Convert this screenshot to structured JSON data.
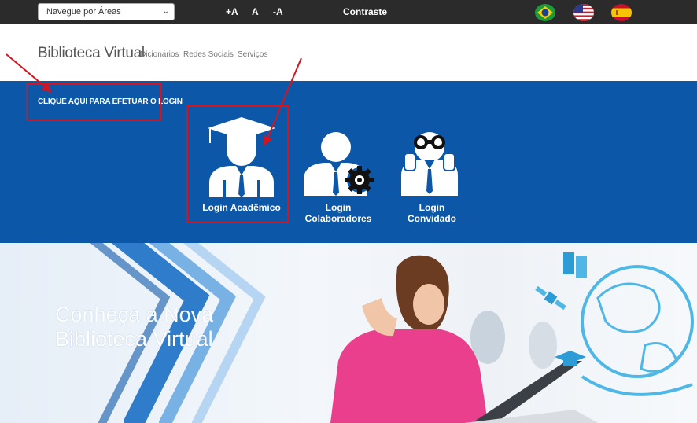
{
  "topbar": {
    "area_select": "Navegue por Áreas",
    "font_increase": "+A",
    "font_normal": "A",
    "font_decrease": "-A",
    "contrast": "Contraste"
  },
  "header": {
    "brand": "Biblioteca Virtual",
    "nav": [
      "Dicionários",
      "Redes Sociais",
      "Serviços"
    ]
  },
  "band": {
    "cta": "CLIQUE AQUI PARA EFETUAR O LOGIN",
    "tiles": [
      {
        "line1": "Login Acadêmico",
        "line2": ""
      },
      {
        "line1": "Login",
        "line2": "Colaboradores"
      },
      {
        "line1": "Login",
        "line2": "Convidado"
      }
    ]
  },
  "hero": {
    "line1": "Conheça a Nova",
    "line2": "Biblioteca Virtual"
  },
  "colors": {
    "topbar": "#2b2b2b",
    "band": "#0c57a8",
    "annotation": "#d5141f"
  }
}
